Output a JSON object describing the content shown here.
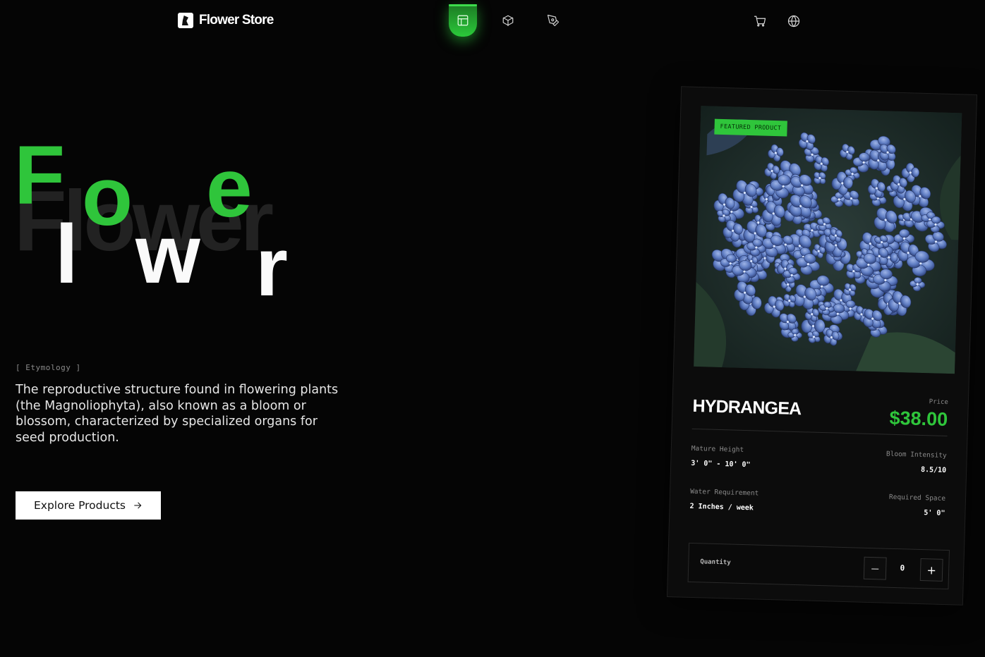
{
  "brand": {
    "name": "Flower Store",
    "logo_icon": "flower-logo-icon"
  },
  "nav": {
    "items": [
      {
        "name": "layout-icon",
        "active": true
      },
      {
        "name": "box-icon",
        "active": false
      },
      {
        "name": "pen-tool-icon",
        "active": false
      }
    ]
  },
  "actions": {
    "items": [
      "cart-icon",
      "globe-icon"
    ]
  },
  "hero": {
    "word": "Flower",
    "letters": [
      {
        "char": "F",
        "color": "#2fc53b"
      },
      {
        "char": "l",
        "color": "#fafafa"
      },
      {
        "char": "o",
        "color": "#2fc53b"
      },
      {
        "char": "w",
        "color": "#fafafa"
      },
      {
        "char": "e",
        "color": "#2fc53b"
      },
      {
        "char": "r",
        "color": "#fafafa"
      }
    ]
  },
  "etymology": {
    "label": "[ Etymology ]",
    "text": "The reproductive structure found in flowering plants (the Magnoliophyta), also known as a bloom or blossom, characterized by specialized organs for seed production."
  },
  "cta": {
    "label": "Explore Products",
    "icon": "arrow-right-icon"
  },
  "product": {
    "badge": "FEATURED PRODUCT",
    "name": "HYDRANGEA",
    "price_label": "Price",
    "price": "$38.00",
    "specs": {
      "mature_height_label": "Mature Height",
      "mature_height": "3' 0\" - 10' 0\"",
      "bloom_intensity_label": "Bloom Intensity",
      "bloom_intensity": "8.5/10",
      "water_label": "Water Requirement",
      "water": "2 Inches / week",
      "space_label": "Required Space",
      "space": "5' 0\""
    },
    "quantity_label": "Quantity",
    "quantity": "0",
    "minus": "−",
    "plus": "+"
  },
  "colors": {
    "accent": "#2fc53b",
    "background": "#050505",
    "ghost": "#1f1f1f"
  }
}
